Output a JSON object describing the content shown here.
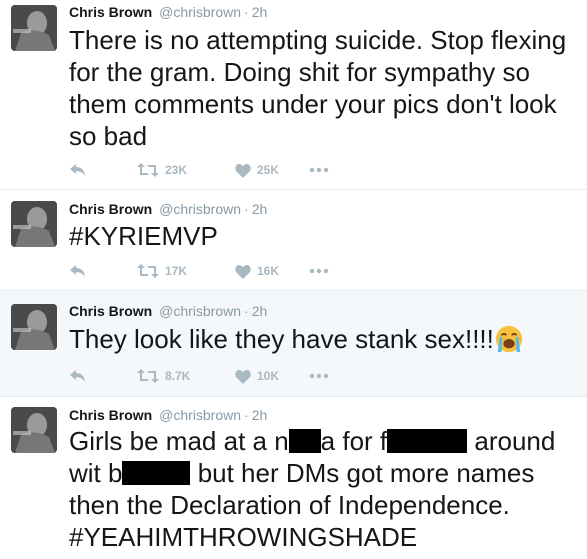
{
  "tweets": [
    {
      "name": "Chris Brown",
      "handle": "@chrisbrown",
      "time": "2h",
      "lines": [
        "There is no attempting suicide. Stop flexing",
        "for the gram. Doing shit for sympathy so",
        "them comments under your pics don't look",
        "so bad"
      ],
      "retweets": "23K",
      "likes": "25K"
    },
    {
      "name": "Chris Brown",
      "handle": "@chrisbrown",
      "time": "2h",
      "lines": [
        "#KYRIEMVP"
      ],
      "retweets": "17K",
      "likes": "16K"
    },
    {
      "name": "Chris Brown",
      "handle": "@chrisbrown",
      "time": "2h",
      "lines": [
        "They look like they have stank sex!!!!"
      ],
      "emoji": "loudly-crying-face",
      "retweets": "8.7K",
      "likes": "10K"
    },
    {
      "name": "Chris Brown",
      "handle": "@chrisbrown",
      "time": "2h",
      "line1": {
        "a": "Girls be mad at a n",
        "b": "a for f",
        "c": " around"
      },
      "line2": {
        "a": "wit b",
        "b": " but her DMs got more names"
      },
      "lines_rest": [
        "then the Declaration of Independence.",
        "#YEAHIMTHROWINGSHADE"
      ]
    }
  ],
  "dot": "·",
  "colors": {
    "text": "#14171a",
    "muted": "#8899a6",
    "icon": "#aab8c2",
    "divider": "#e6ecf0",
    "highlight_bg": "#f5f8fa"
  },
  "icons": [
    "reply-icon",
    "retweet-icon",
    "heart-icon",
    "more-icon"
  ]
}
